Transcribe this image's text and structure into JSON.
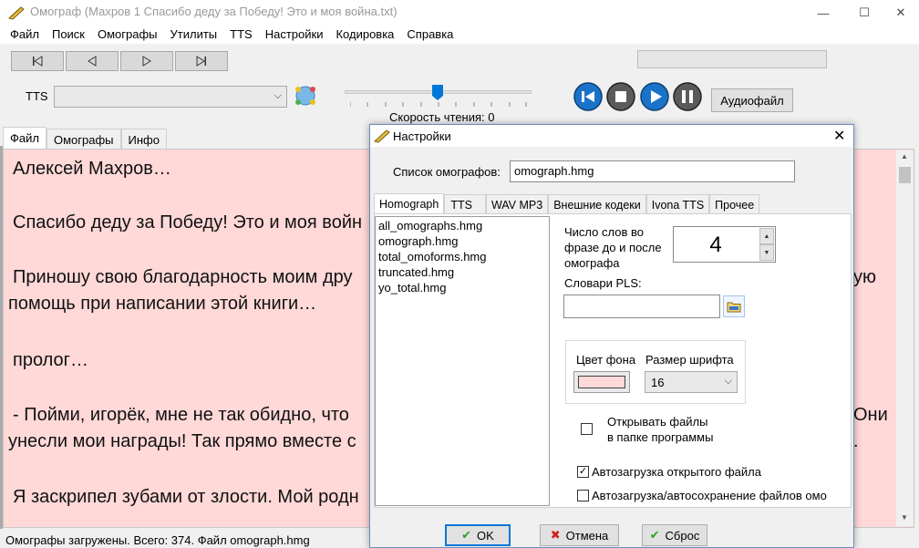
{
  "window": {
    "title": "Омограф (Махров 1 Спасибо деду за Победу! Это и моя война.txt)",
    "minimize_glyph": "—",
    "maximize_glyph": "☐",
    "close_glyph": "✕"
  },
  "menu": [
    "Файл",
    "Поиск",
    "Омографы",
    "Утилиты",
    "TTS",
    "Настройки",
    "Кодировка",
    "Справка"
  ],
  "toolbar": {
    "tts_label": "TTS",
    "tts_value": "",
    "speed_label": "Скорость чтения: 0",
    "audio_button": "Аудиофайл"
  },
  "main_tabs": [
    "Файл",
    "Омографы",
    "Инфо"
  ],
  "document_lines": [
    "Алексей Махров…",
    "Спасибо деду за Победу! Это и моя войн",
    "Приношу свою благодарность моим дру",
    "помощь при написании этой книги…",
    "пролог…",
    "- Пойми, игорёк, мне не так обидно, что",
    "унесли мои награды! Так прямо вместе с",
    "Я заскрипел зубами от злости. Мой родн"
  ],
  "document_right_fragments": [
    "ую",
    "Они",
    "."
  ],
  "status": "Омографы загружены. Всего: 374. Файл omograph.hmg",
  "dialog": {
    "title": "Настройки",
    "close_glyph": "✕",
    "omograph_list_label": "Список омографов:",
    "omograph_list_value": "omograph.hmg",
    "tabs": [
      "Homograph",
      "TTS",
      "WAV MP3",
      "Внешние кодеки",
      "Ivona TTS",
      "Прочее"
    ],
    "active_tab": "Homograph",
    "files": [
      "all_omographs.hmg",
      "omograph.hmg",
      "total_omoforms.hmg",
      "truncated.hmg",
      "yo_total.hmg"
    ],
    "words_label": "Число слов во фразе до и после омографа",
    "words_value": "4",
    "pls_label": "Словари PLS:",
    "pls_value": "",
    "bg_color_label": "Цвет фона",
    "bg_color": "#ffd8d8",
    "font_size_label": "Размер шрифта",
    "font_size_value": "16",
    "open_files_label": "Открывать файлы в папке программы",
    "open_files_checked": false,
    "autoload_label": "Автозагрузка открытого файла",
    "autoload_checked": true,
    "autosave_label": "Автозагрузка/автосохранение файлов омо",
    "autosave_checked": false,
    "ok": "OK",
    "cancel": "Отмена",
    "reset": "Сброс"
  },
  "colors": {
    "text_background": "#ffd8d8",
    "accent": "#0078d7",
    "player_blue": "#1a73c9"
  }
}
